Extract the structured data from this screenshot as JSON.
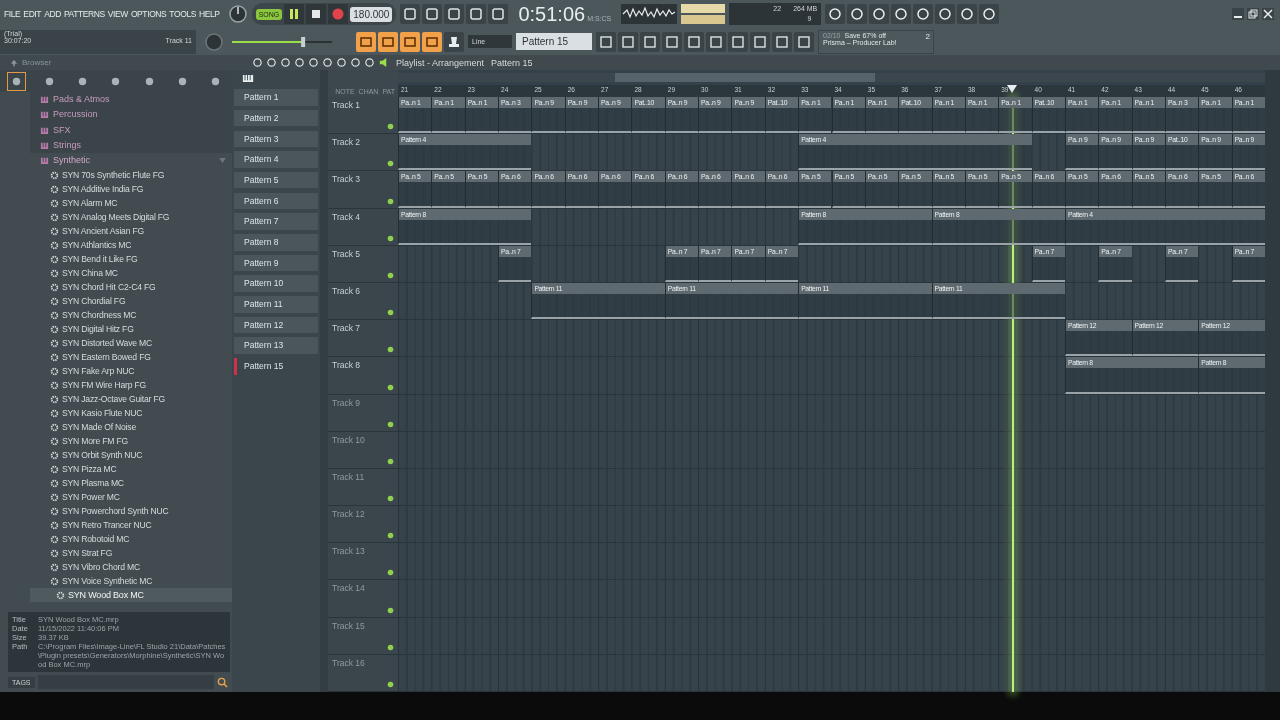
{
  "menu": [
    "FILE",
    "EDIT",
    "ADD",
    "PATTERNS",
    "VIEW",
    "OPTIONS",
    "TOOLS",
    "HELP"
  ],
  "hint": {
    "mode": "(Trial)",
    "time": "30:07:20",
    "target": "Track 11"
  },
  "transport": {
    "mode_label": "SONG",
    "song_mode": true,
    "tempo": "180.000",
    "time": "0:51:06",
    "time_unit": "M:S:CS"
  },
  "master_volume": {
    "level": 0.72
  },
  "monitor": {
    "cpu": "22",
    "ram": "264 MB",
    "polyphony": "9"
  },
  "snap": {
    "value": "Line"
  },
  "pattern_selector": {
    "value": "Pattern 15"
  },
  "news": {
    "counter": "02/10",
    "headline": "Save 67% off",
    "text": "Prisma – Producer Lab!",
    "badge": "2"
  },
  "browser": {
    "title": "Browser",
    "categories": [
      {
        "label": "Pads & Atmos",
        "expanded": false
      },
      {
        "label": "Percussion",
        "expanded": false
      },
      {
        "label": "SFX",
        "expanded": false
      },
      {
        "label": "Strings",
        "expanded": false
      },
      {
        "label": "Synthetic",
        "expanded": true,
        "children": [
          {
            "label": "SYN 70s Synthetic Flute FG",
            "selected": false
          },
          {
            "label": "SYN Additive India FG",
            "selected": false
          },
          {
            "label": "SYN Alarm MC",
            "selected": false
          },
          {
            "label": "SYN Analog Meets Digital FG",
            "selected": false
          },
          {
            "label": "SYN Ancient Asian FG",
            "selected": false
          },
          {
            "label": "SYN Athlantics MC",
            "selected": false
          },
          {
            "label": "SYN Bend it Like FG",
            "selected": false
          },
          {
            "label": "SYN China MC",
            "selected": false
          },
          {
            "label": "SYN Chord Hit C2-C4 FG",
            "selected": false
          },
          {
            "label": "SYN Chordial FG",
            "selected": false
          },
          {
            "label": "SYN Chordness MC",
            "selected": false
          },
          {
            "label": "SYN Digital Hitz FG",
            "selected": false
          },
          {
            "label": "SYN Distorted Wave MC",
            "selected": false
          },
          {
            "label": "SYN Eastern Bowed FG",
            "selected": false
          },
          {
            "label": "SYN Fake Arp NUC",
            "selected": false
          },
          {
            "label": "SYN FM Wire Harp FG",
            "selected": false
          },
          {
            "label": "SYN Jazz-Octave Guitar FG",
            "selected": false
          },
          {
            "label": "SYN Kasio Flute NUC",
            "selected": false
          },
          {
            "label": "SYN Made Of Noise",
            "selected": false
          },
          {
            "label": "SYN More FM FG",
            "selected": false
          },
          {
            "label": "SYN Orbit Synth NUC",
            "selected": false
          },
          {
            "label": "SYN Pizza MC",
            "selected": false
          },
          {
            "label": "SYN Plasma MC",
            "selected": false
          },
          {
            "label": "SYN Power MC",
            "selected": false
          },
          {
            "label": "SYN Powerchord Synth NUC",
            "selected": false
          },
          {
            "label": "SYN Retro Trancer NUC",
            "selected": false
          },
          {
            "label": "SYN Robotoid MC",
            "selected": false
          },
          {
            "label": "SYN Strat FG",
            "selected": false
          },
          {
            "label": "SYN Vibro Chord MC",
            "selected": false
          },
          {
            "label": "SYN Voice Synthetic MC",
            "selected": false
          },
          {
            "label": "SYN Wood Box MC",
            "selected": true
          }
        ]
      }
    ],
    "info": [
      {
        "key": "Title",
        "value": "SYN Wood Box MC.mrp"
      },
      {
        "key": "Date",
        "value": "11/15/2022 11:40:06 PM"
      },
      {
        "key": "Size",
        "value": "39.37 KB"
      },
      {
        "key": "Path",
        "value": "C:\\Program Files\\Image-Line\\FL Studio 21\\Data\\Patches\\Plugin presets\\Generators\\Morphine\\Synthetic\\SYN Wood Box MC.mrp"
      }
    ],
    "tags_label": "TAGS"
  },
  "playlist": {
    "title": "Playlist - Arrangement",
    "pattern": "Pattern 15",
    "column_labels": [
      "NOTE",
      "CHAN",
      "PAT"
    ],
    "patterns": [
      {
        "label": "Pattern 1",
        "selected": false
      },
      {
        "label": "Pattern 2",
        "selected": false
      },
      {
        "label": "Pattern 3",
        "selected": false
      },
      {
        "label": "Pattern 4",
        "selected": false
      },
      {
        "label": "Pattern 5",
        "selected": false
      },
      {
        "label": "Pattern 6",
        "selected": false
      },
      {
        "label": "Pattern 7",
        "selected": false
      },
      {
        "label": "Pattern 8",
        "selected": false
      },
      {
        "label": "Pattern 9",
        "selected": false
      },
      {
        "label": "Pattern 10",
        "selected": false
      },
      {
        "label": "Pattern 11",
        "selected": false
      },
      {
        "label": "Pattern 12",
        "selected": false
      },
      {
        "label": "Pattern 13",
        "selected": false
      },
      {
        "label": "Pattern 15",
        "selected": true
      }
    ],
    "ruler": [
      "21",
      "22",
      "23",
      "24",
      "25",
      "26",
      "27",
      "28",
      "29",
      "30",
      "31",
      "32",
      "33",
      "34",
      "35",
      "36",
      "37",
      "38",
      "39",
      "40",
      "41",
      "42",
      "43",
      "44",
      "45",
      "46"
    ],
    "playhead": {
      "level": 0.708
    },
    "tracks": [
      {
        "name": "Track 1",
        "empty": false,
        "lane": [
          {
            "kind": "start",
            "label": "Pa..n 1"
          },
          {
            "kind": "start",
            "label": "Pa..n 1"
          },
          {
            "kind": "start",
            "label": "Pa..n 1"
          },
          {
            "kind": "start",
            "label": "Pa..n 3"
          },
          {
            "kind": "start",
            "label": "Pa..n 9"
          },
          {
            "kind": "start",
            "label": "Pa..n 9"
          },
          {
            "kind": "start",
            "label": "Pa..n 9"
          },
          {
            "kind": "start",
            "label": "Pat..10"
          },
          {
            "kind": "start",
            "label": "Pa..n 9"
          },
          {
            "kind": "start",
            "label": "Pa..n 9"
          },
          {
            "kind": "start",
            "label": "Pa..n 9"
          },
          {
            "kind": "start",
            "label": "Pat..10"
          },
          {
            "kind": "start",
            "label": "Pa..n 1"
          },
          {
            "kind": "start",
            "label": "Pa..n 1"
          },
          {
            "kind": "start",
            "label": "Pa..n 1"
          },
          {
            "kind": "start",
            "label": "Pat..10"
          },
          {
            "kind": "start",
            "label": "Pa..n 1"
          },
          {
            "kind": "start",
            "label": "Pa..n 1"
          },
          {
            "kind": "start",
            "label": "Pa..n 1"
          },
          {
            "kind": "start",
            "label": "Pat..10"
          },
          {
            "kind": "start",
            "label": "Pa..n 1"
          },
          {
            "kind": "start",
            "label": "Pa..n 1"
          },
          {
            "kind": "start",
            "label": "Pa..n 1"
          },
          {
            "kind": "start",
            "label": "Pa..n 3"
          },
          {
            "kind": "start",
            "label": "Pa..n 1"
          },
          {
            "kind": "start",
            "label": "Pa..n 1"
          }
        ]
      },
      {
        "name": "Track 2",
        "empty": false,
        "lane": [
          {
            "kind": "start",
            "label": "Pattern 4"
          },
          {
            "kind": "cont"
          },
          {
            "kind": "cont"
          },
          {
            "kind": "cont"
          },
          {
            "kind": "gap"
          },
          {
            "kind": "gap"
          },
          {
            "kind": "gap"
          },
          {
            "kind": "gap"
          },
          {
            "kind": "gap"
          },
          {
            "kind": "gap"
          },
          {
            "kind": "gap"
          },
          {
            "kind": "gap"
          },
          {
            "kind": "start",
            "label": "Pattern 4"
          },
          {
            "kind": "cont"
          },
          {
            "kind": "cont"
          },
          {
            "kind": "cont"
          },
          {
            "kind": "cont"
          },
          {
            "kind": "cont"
          },
          {
            "kind": "cont"
          },
          {
            "kind": "gap"
          },
          {
            "kind": "start",
            "label": "Pa..n 9"
          },
          {
            "kind": "start",
            "label": "Pa..n 9"
          },
          {
            "kind": "start",
            "label": "Pa..n 9"
          },
          {
            "kind": "start",
            "label": "Pat..10"
          },
          {
            "kind": "start",
            "label": "Pa..n 9"
          },
          {
            "kind": "start",
            "label": "Pa..n 9"
          }
        ]
      },
      {
        "name": "Track 3",
        "empty": false,
        "lane": [
          {
            "kind": "start",
            "label": "Pa..n 5"
          },
          {
            "kind": "start",
            "label": "Pa..n 5"
          },
          {
            "kind": "start",
            "label": "Pa..n 5"
          },
          {
            "kind": "start",
            "label": "Pa..n 6"
          },
          {
            "kind": "start",
            "label": "Pa..n 6"
          },
          {
            "kind": "start",
            "label": "Pa..n 6"
          },
          {
            "kind": "start",
            "label": "Pa..n 6"
          },
          {
            "kind": "start",
            "label": "Pa..n 6"
          },
          {
            "kind": "start",
            "label": "Pa..n 6"
          },
          {
            "kind": "start",
            "label": "Pa..n 6"
          },
          {
            "kind": "start",
            "label": "Pa..n 6"
          },
          {
            "kind": "start",
            "label": "Pa..n 6"
          },
          {
            "kind": "start",
            "label": "Pa..n 5"
          },
          {
            "kind": "start",
            "label": "Pa..n 5"
          },
          {
            "kind": "start",
            "label": "Pa..n 5"
          },
          {
            "kind": "start",
            "label": "Pa..n 5"
          },
          {
            "kind": "start",
            "label": "Pa..n 5"
          },
          {
            "kind": "start",
            "label": "Pa..n 5"
          },
          {
            "kind": "start",
            "label": "Pa..n 5"
          },
          {
            "kind": "start",
            "label": "Pa..n 6"
          },
          {
            "kind": "start",
            "label": "Pa..n 5"
          },
          {
            "kind": "start",
            "label": "Pa..n 6"
          },
          {
            "kind": "start",
            "label": "Pa..n 5"
          },
          {
            "kind": "start",
            "label": "Pa..n 6"
          },
          {
            "kind": "start",
            "label": "Pa..n 5"
          },
          {
            "kind": "start",
            "label": "Pa..n 6"
          }
        ]
      },
      {
        "name": "Track 4",
        "empty": false,
        "lane": [
          {
            "kind": "start",
            "label": "Pattern 8"
          },
          {
            "kind": "cont"
          },
          {
            "kind": "cont"
          },
          {
            "kind": "cont"
          },
          {
            "kind": "gap"
          },
          {
            "kind": "gap"
          },
          {
            "kind": "gap"
          },
          {
            "kind": "gap"
          },
          {
            "kind": "gap"
          },
          {
            "kind": "gap"
          },
          {
            "kind": "gap"
          },
          {
            "kind": "gap"
          },
          {
            "kind": "start",
            "label": "Pattern 8"
          },
          {
            "kind": "cont"
          },
          {
            "kind": "cont"
          },
          {
            "kind": "cont"
          },
          {
            "kind": "start",
            "label": "Pattern 8"
          },
          {
            "kind": "cont"
          },
          {
            "kind": "cont"
          },
          {
            "kind": "cont"
          },
          {
            "kind": "start",
            "label": "Pattern 4"
          },
          {
            "kind": "cont"
          },
          {
            "kind": "cont"
          },
          {
            "kind": "cont"
          },
          {
            "kind": "cont"
          },
          {
            "kind": "cont"
          }
        ]
      },
      {
        "name": "Track 5",
        "empty": false,
        "lane": [
          {
            "kind": "gap"
          },
          {
            "kind": "gap"
          },
          {
            "kind": "gap"
          },
          {
            "kind": "start",
            "label": "Pa..n 7"
          },
          {
            "kind": "gap"
          },
          {
            "kind": "gap"
          },
          {
            "kind": "gap"
          },
          {
            "kind": "gap"
          },
          {
            "kind": "start",
            "label": "Pa..n 7"
          },
          {
            "kind": "start",
            "label": "Pa..n 7"
          },
          {
            "kind": "start",
            "label": "Pa..n 7"
          },
          {
            "kind": "start",
            "label": "Pa..n 7"
          },
          {
            "kind": "gap"
          },
          {
            "kind": "gap"
          },
          {
            "kind": "gap"
          },
          {
            "kind": "gap"
          },
          {
            "kind": "gap"
          },
          {
            "kind": "gap"
          },
          {
            "kind": "gap"
          },
          {
            "kind": "start",
            "label": "Pa..n 7"
          },
          {
            "kind": "gap"
          },
          {
            "kind": "start",
            "label": "Pa..n 7"
          },
          {
            "kind": "gap"
          },
          {
            "kind": "start",
            "label": "Pa..n 7"
          },
          {
            "kind": "gap"
          },
          {
            "kind": "start",
            "label": "Pa..n 7"
          }
        ]
      },
      {
        "name": "Track 6",
        "empty": false,
        "lane": [
          {
            "kind": "gap"
          },
          {
            "kind": "gap"
          },
          {
            "kind": "gap"
          },
          {
            "kind": "gap"
          },
          {
            "kind": "start",
            "label": "Pattern 11"
          },
          {
            "kind": "cont"
          },
          {
            "kind": "cont"
          },
          {
            "kind": "cont"
          },
          {
            "kind": "start",
            "label": "Pattern 11"
          },
          {
            "kind": "cont"
          },
          {
            "kind": "cont"
          },
          {
            "kind": "cont"
          },
          {
            "kind": "start",
            "label": "Pattern 11"
          },
          {
            "kind": "cont"
          },
          {
            "kind": "cont"
          },
          {
            "kind": "cont"
          },
          {
            "kind": "start",
            "label": "Pattern 11"
          },
          {
            "kind": "cont"
          },
          {
            "kind": "cont"
          },
          {
            "kind": "cont"
          },
          {
            "kind": "gap"
          },
          {
            "kind": "gap"
          },
          {
            "kind": "gap"
          },
          {
            "kind": "gap"
          },
          {
            "kind": "gap"
          },
          {
            "kind": "gap"
          }
        ]
      },
      {
        "name": "Track 7",
        "empty": false,
        "lane": [
          {
            "kind": "gap"
          },
          {
            "kind": "gap"
          },
          {
            "kind": "gap"
          },
          {
            "kind": "gap"
          },
          {
            "kind": "gap"
          },
          {
            "kind": "gap"
          },
          {
            "kind": "gap"
          },
          {
            "kind": "gap"
          },
          {
            "kind": "gap"
          },
          {
            "kind": "gap"
          },
          {
            "kind": "gap"
          },
          {
            "kind": "gap"
          },
          {
            "kind": "gap"
          },
          {
            "kind": "gap"
          },
          {
            "kind": "gap"
          },
          {
            "kind": "gap"
          },
          {
            "kind": "gap"
          },
          {
            "kind": "gap"
          },
          {
            "kind": "gap"
          },
          {
            "kind": "gap"
          },
          {
            "kind": "start",
            "label": "Pattern 12"
          },
          {
            "kind": "cont"
          },
          {
            "kind": "start",
            "label": "Pattern 12"
          },
          {
            "kind": "cont"
          },
          {
            "kind": "start",
            "label": "Pattern 12"
          },
          {
            "kind": "cont"
          }
        ]
      },
      {
        "name": "Track 8",
        "empty": false,
        "lane": [
          {
            "kind": "gap"
          },
          {
            "kind": "gap"
          },
          {
            "kind": "gap"
          },
          {
            "kind": "gap"
          },
          {
            "kind": "gap"
          },
          {
            "kind": "gap"
          },
          {
            "kind": "gap"
          },
          {
            "kind": "gap"
          },
          {
            "kind": "gap"
          },
          {
            "kind": "gap"
          },
          {
            "kind": "gap"
          },
          {
            "kind": "gap"
          },
          {
            "kind": "gap"
          },
          {
            "kind": "gap"
          },
          {
            "kind": "gap"
          },
          {
            "kind": "gap"
          },
          {
            "kind": "gap"
          },
          {
            "kind": "gap"
          },
          {
            "kind": "gap"
          },
          {
            "kind": "gap"
          },
          {
            "kind": "start",
            "label": "Pattern 8"
          },
          {
            "kind": "cont"
          },
          {
            "kind": "cont"
          },
          {
            "kind": "cont"
          },
          {
            "kind": "start",
            "label": "Pattern 8"
          },
          {
            "kind": "cont"
          }
        ]
      },
      {
        "name": "Track 9",
        "empty": true
      },
      {
        "name": "Track 10",
        "empty": true
      },
      {
        "name": "Track 11",
        "empty": true
      },
      {
        "name": "Track 12",
        "empty": true
      },
      {
        "name": "Track 13",
        "empty": true
      },
      {
        "name": "Track 14",
        "empty": true
      },
      {
        "name": "Track 15",
        "empty": true
      },
      {
        "name": "Track 16",
        "empty": true
      }
    ]
  }
}
